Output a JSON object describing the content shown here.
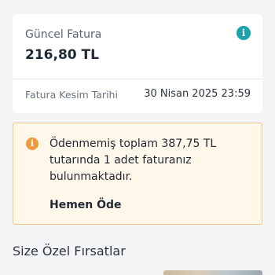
{
  "invoice": {
    "label": "Güncel Fatura",
    "amount": "216,80 TL",
    "info_icon": "info-icon",
    "due_label": "Fatura Kesim Tarihi",
    "due_value": "30 Nisan 2025 23:59"
  },
  "alert": {
    "icon": "warning-info-icon",
    "message": "Ödenmemiş toplam 387,75 TL tutarında 1 adet faturanız bulunmaktadır.",
    "action_label": "Hemen Öde"
  },
  "offers": {
    "title": "Size Özel Fırsatlar"
  },
  "colors": {
    "accent_teal": "#1aa3ad",
    "warning_orange": "#ee9b3e",
    "alert_background": "#fff7ea",
    "alert_border": "#f4c48a"
  }
}
